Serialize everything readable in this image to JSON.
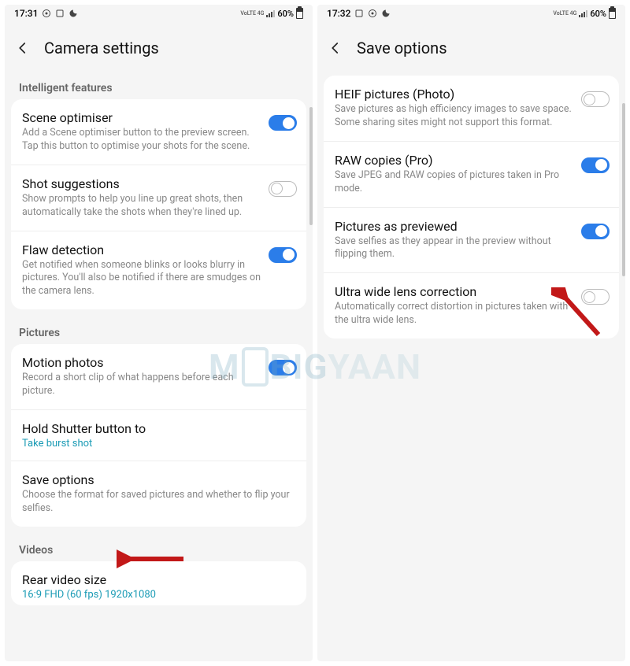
{
  "watermark": "MOBIGYAAN",
  "left": {
    "status": {
      "time": "17:31",
      "net_label": "VoLTE 4G",
      "battery": "60%"
    },
    "header": {
      "title": "Camera settings"
    },
    "sections": [
      {
        "label": "Intelligent features",
        "rows": [
          {
            "title": "Scene optimiser",
            "desc": "Add a Scene optimiser button to the preview screen. Tap this button to optimise your shots for the scene.",
            "toggle": "on"
          },
          {
            "title": "Shot suggestions",
            "desc": "Show prompts to help you line up great shots, then automatically take the shots when they're lined up.",
            "toggle": "off"
          },
          {
            "title": "Flaw detection",
            "desc": "Get notified when someone blinks or looks blurry in pictures. You'll also be notified if there are smudges on the camera lens.",
            "toggle": "on"
          }
        ]
      },
      {
        "label": "Pictures",
        "rows": [
          {
            "title": "Motion photos",
            "desc": "Record a short clip of what happens before each picture.",
            "toggle": "on"
          },
          {
            "title": "Hold Shutter button to",
            "link": "Take burst shot"
          },
          {
            "title": "Save options",
            "desc": "Choose the format for saved pictures and whether to flip your selfies."
          }
        ]
      },
      {
        "label": "Videos",
        "rows": [
          {
            "title": "Rear video size",
            "link": "16:9 FHD (60 fps) 1920x1080"
          }
        ]
      }
    ]
  },
  "right": {
    "status": {
      "time": "17:32",
      "net_label": "VoLTE 4G",
      "battery": "60%"
    },
    "header": {
      "title": "Save options"
    },
    "rows": [
      {
        "title": "HEIF pictures (Photo)",
        "desc": "Save pictures as high efficiency images to save space. Some sharing sites might not support this format.",
        "toggle": "off"
      },
      {
        "title": "RAW copies (Pro)",
        "desc": "Save JPEG and RAW copies of pictures taken in Pro mode.",
        "toggle": "on"
      },
      {
        "title": "Pictures as previewed",
        "desc": "Save selfies as they appear in the preview without flipping them.",
        "toggle": "on"
      },
      {
        "title": "Ultra wide lens correction",
        "desc": "Automatically correct distortion in pictures taken with the ultra wide lens.",
        "toggle": "off"
      }
    ]
  }
}
